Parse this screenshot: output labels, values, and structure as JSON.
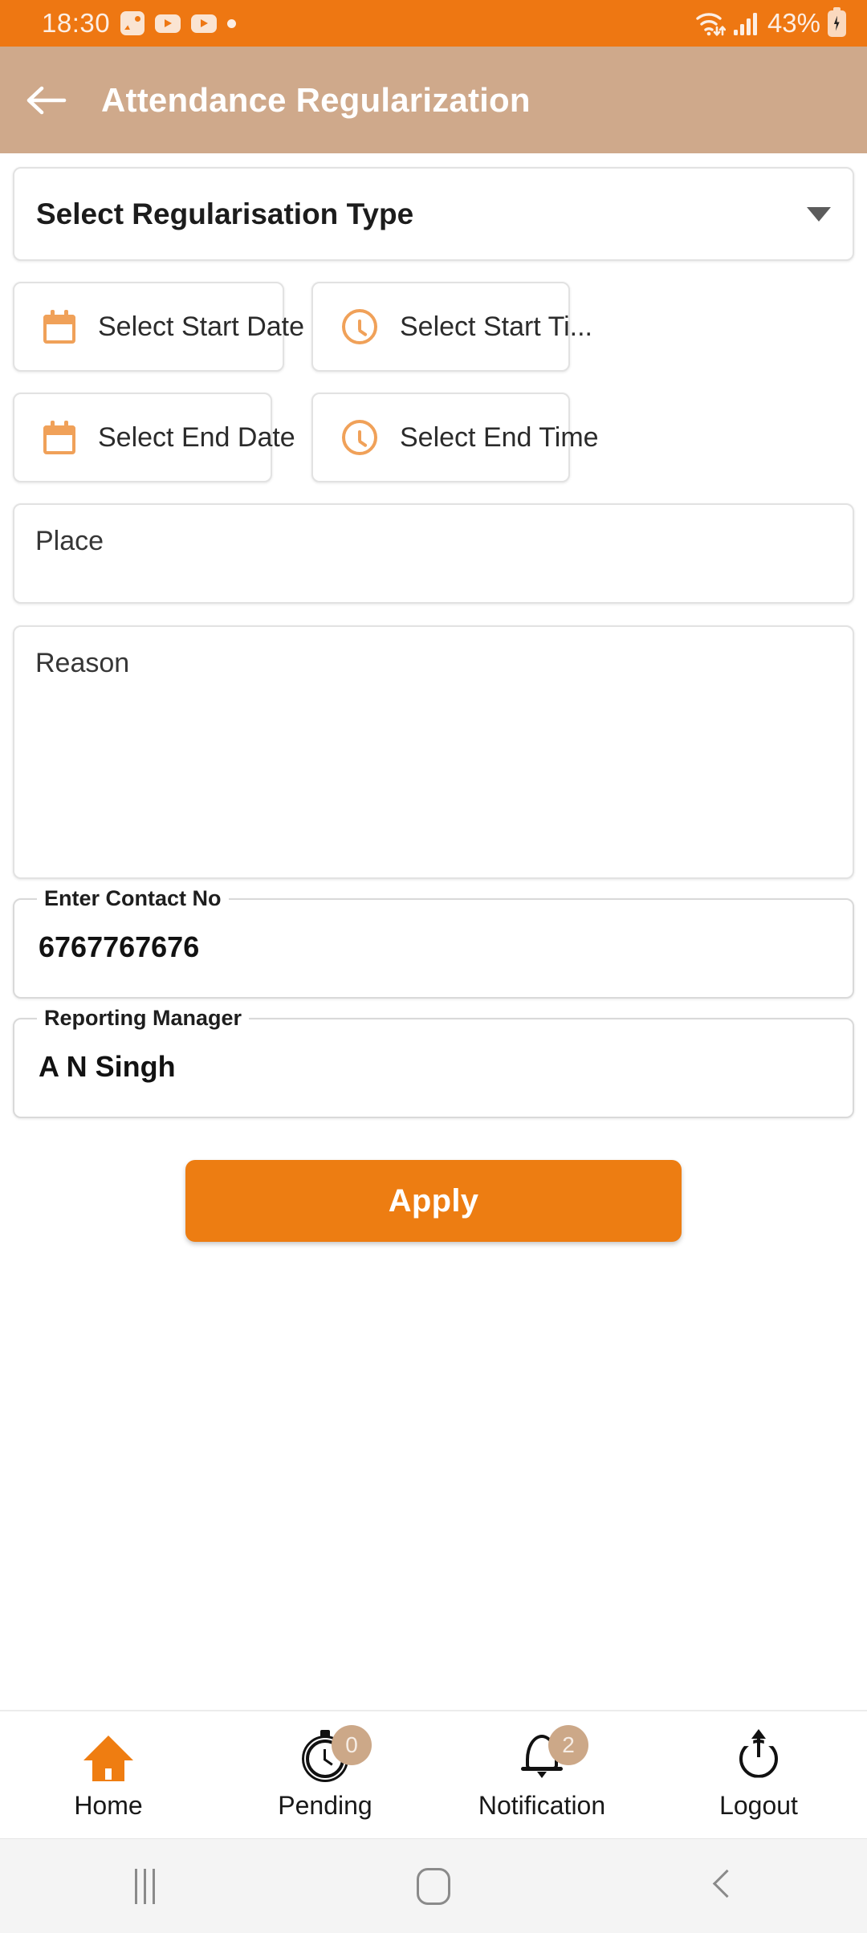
{
  "statusbar": {
    "time": "18:30",
    "battery_percent": "43%",
    "icons": [
      "gallery-icon",
      "youtube-icon",
      "youtube-icon",
      "dot-icon",
      "wifi-icon",
      "signal-icon",
      "battery-charging-icon"
    ]
  },
  "appbar": {
    "title": "Attendance Regularization",
    "back_icon": "arrow-left-icon"
  },
  "form": {
    "regularisation_type": {
      "label": "Select Regularisation Type",
      "caret_icon": "chevron-down-icon"
    },
    "start_date": {
      "label": "Select Start Date",
      "icon": "calendar-icon"
    },
    "start_time": {
      "label": "Select Start Ti...",
      "icon": "clock-icon"
    },
    "end_date": {
      "label": "Select End Date",
      "icon": "calendar-icon"
    },
    "end_time": {
      "label": "Select End Time",
      "icon": "clock-icon"
    },
    "place": {
      "placeholder": "Place",
      "value": ""
    },
    "reason": {
      "placeholder": "Reason",
      "value": ""
    },
    "contact_no": {
      "label": "Enter Contact No",
      "value": "6767767676"
    },
    "reporting_manager": {
      "label": "Reporting Manager",
      "value": "A N Singh"
    },
    "apply_button": "Apply"
  },
  "bottomnav": {
    "items": [
      {
        "label": "Home",
        "icon": "home-icon",
        "badge": null,
        "active": true
      },
      {
        "label": "Pending",
        "icon": "stopwatch-icon",
        "badge": "0",
        "active": false
      },
      {
        "label": "Notification",
        "icon": "bell-icon",
        "badge": "2",
        "active": false
      },
      {
        "label": "Logout",
        "icon": "power-icon",
        "badge": null,
        "active": false
      }
    ]
  },
  "androidnav": {
    "recents": "recents-icon",
    "home": "home-pill-icon",
    "back": "back-chevron-icon"
  },
  "colors": {
    "status_bar": "#EE7712",
    "app_bar": "#CFA98B",
    "accent_orange": "#ED7D12",
    "icon_orange": "#F0A159",
    "badge_tan": "#CCA888",
    "border_grey": "#E2E2E2"
  }
}
